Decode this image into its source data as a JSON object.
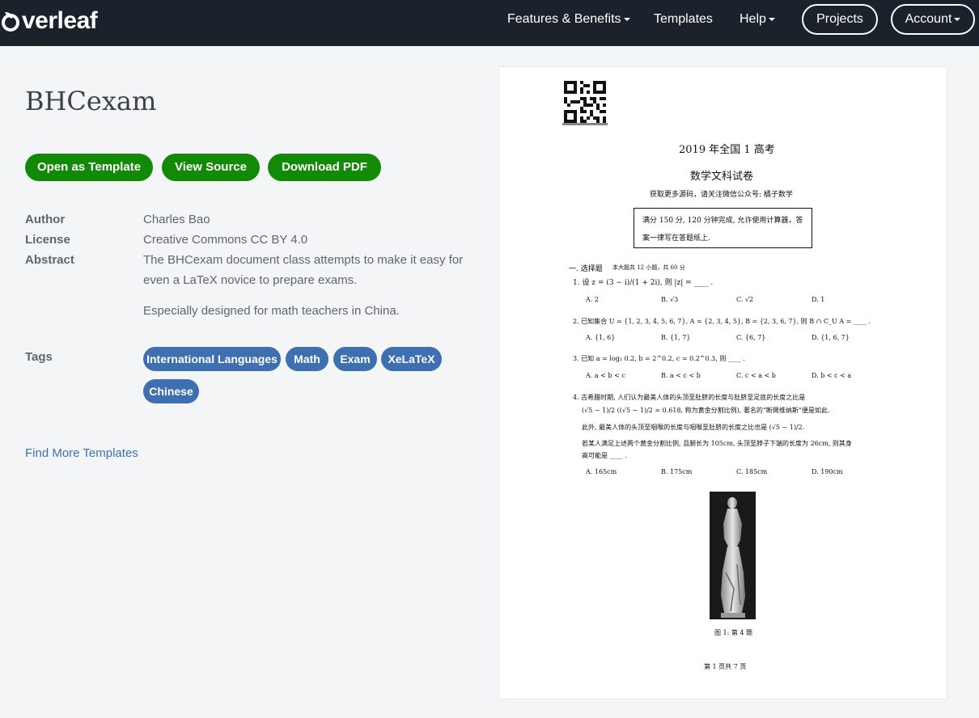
{
  "nav": {
    "logo_text": "verleaf",
    "features": "Features & Benefits",
    "templates": "Templates",
    "help": "Help",
    "projects": "Projects",
    "account": "Account"
  },
  "page": {
    "title": "BHCexam",
    "buttons": {
      "open_template": "Open as Template",
      "view_source": "View Source",
      "download_pdf": "Download PDF"
    },
    "meta": {
      "author_label": "Author",
      "author": "Charles Bao",
      "license_label": "License",
      "license": "Creative Commons CC BY 4.0",
      "abstract_label": "Abstract",
      "abstract_1": "The BHCexam document class attempts to make it easy for even a LaTeX novice to prepare exams.",
      "abstract_2": "Especially designed for math teachers in China.",
      "tags_label": "Tags"
    },
    "tags": [
      "International Languages",
      "Math",
      "Exam",
      "XeLaTeX",
      "Chinese"
    ],
    "find_more": "Find More Templates"
  },
  "preview": {
    "heading": "2019 年全国 1 高考",
    "subheading": "数学文科试卷",
    "source_line": "获取更多源码，请关注微信公众号: 橘子数学",
    "notice_1": "满分 150 分, 120 分钟完成, 允许使用计算器，答",
    "notice_2": "案一律写在答题纸上.",
    "section": "一. 选择题",
    "section_note": "本大题共 12 小题，共 60 分",
    "q1": "1.  设 z = (3 − i)/(1 + 2i), 则 |z| = ____ .",
    "q1_opts": [
      "A. 2",
      "B. √3",
      "C. √2",
      "D. 1"
    ],
    "q2": "2.  已知集合 U = {1, 2, 3, 4, 5, 6, 7}, A = {2, 3, 4, 5}, B = {2, 3, 6, 7}, 则 B ∩ C_U A = ____ .",
    "q2_opts": [
      "A. {1, 6}",
      "B. {1, 7}",
      "C. {6, 7}",
      "D. {1, 6, 7}"
    ],
    "q3": "3.  已知 a = log₂ 0.2, b = 2^0.2, c = 0.2^0.3, 则 ____ .",
    "q3_opts": [
      "A. a < b < c",
      "B. a < c < b",
      "C. c < a < b",
      "D. b < c < a"
    ],
    "q4_1": "4.  古希腊时期, 人们认为最美人体的头顶至肚脐的长度与肚脐至足底的长度之比是",
    "q4_2": "(√5 − 1)/2 ((√5 − 1)/2 ≈ 0.618, 称为黄金分割比例), 著名的“断臂维纳斯”便是如此.",
    "q4_3": "此外, 最美人体的头顶至咽喉的长度与咽喉至肚脐的长度之比也是 (√5 − 1)/2.",
    "q4_4": "若某人满足上述两个黄金分割比例, 且腿长为 105cm, 头顶至脖子下端的长度为 26cm, 则其身",
    "q4_5": "高可能是 ____ .",
    "q4_opts": [
      "A. 165cm",
      "B. 175cm",
      "C. 185cm",
      "D. 190cm"
    ],
    "caption": "图 1: 第 4 题",
    "footer": "第 1 页共 7 页"
  },
  "colors": {
    "navbar": "#1b222c",
    "green": "#138a07",
    "tag_blue": "#3d6fb1",
    "text": "#5d6670"
  }
}
